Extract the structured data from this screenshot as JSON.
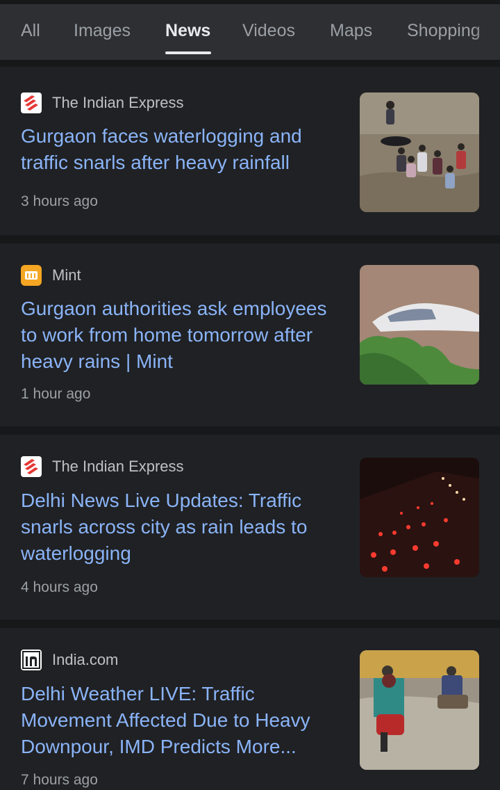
{
  "tabs": [
    {
      "label": "All",
      "active": false
    },
    {
      "label": "Images",
      "active": false
    },
    {
      "label": "News",
      "active": true
    },
    {
      "label": "Videos",
      "active": false
    },
    {
      "label": "Maps",
      "active": false
    },
    {
      "label": "Shopping",
      "active": false
    }
  ],
  "articles": [
    {
      "source": "The Indian Express",
      "source_icon": "indian-express-logo-icon",
      "headline": "Gurgaon faces waterlogging and traffic snarls after heavy rainfall",
      "time": "3 hours ago",
      "thumbnail": "people-wading-flood-image"
    },
    {
      "source": "Mint",
      "source_icon": "mint-logo-icon",
      "headline": "Gurgaon authorities ask employees to work from home tomorrow after heavy rains | Mint",
      "time": "1 hour ago",
      "thumbnail": "submerged-car-image"
    },
    {
      "source": "The Indian Express",
      "source_icon": "indian-express-logo-icon",
      "headline": "Delhi News Live Updates: Traffic snarls across city as rain leads to waterlogging",
      "time": "4 hours ago",
      "thumbnail": "night-traffic-jam-image"
    },
    {
      "source": "India.com",
      "source_icon": "india-com-logo-icon",
      "headline": "Delhi Weather LIVE: Traffic Movement Affected Due to Heavy Downpour, IMD Predicts More...",
      "time": "7 hours ago",
      "thumbnail": "scooter-in-flood-image"
    }
  ],
  "colors": {
    "background": "#202124",
    "separator": "#17181a",
    "tab_bar": "#2e2f32",
    "headline": "#8ab4f8",
    "source_text": "#bdc1c6",
    "meta_text": "#9aa0a6",
    "indian_express_red": "#e53935",
    "mint_orange": "#f5a623"
  }
}
